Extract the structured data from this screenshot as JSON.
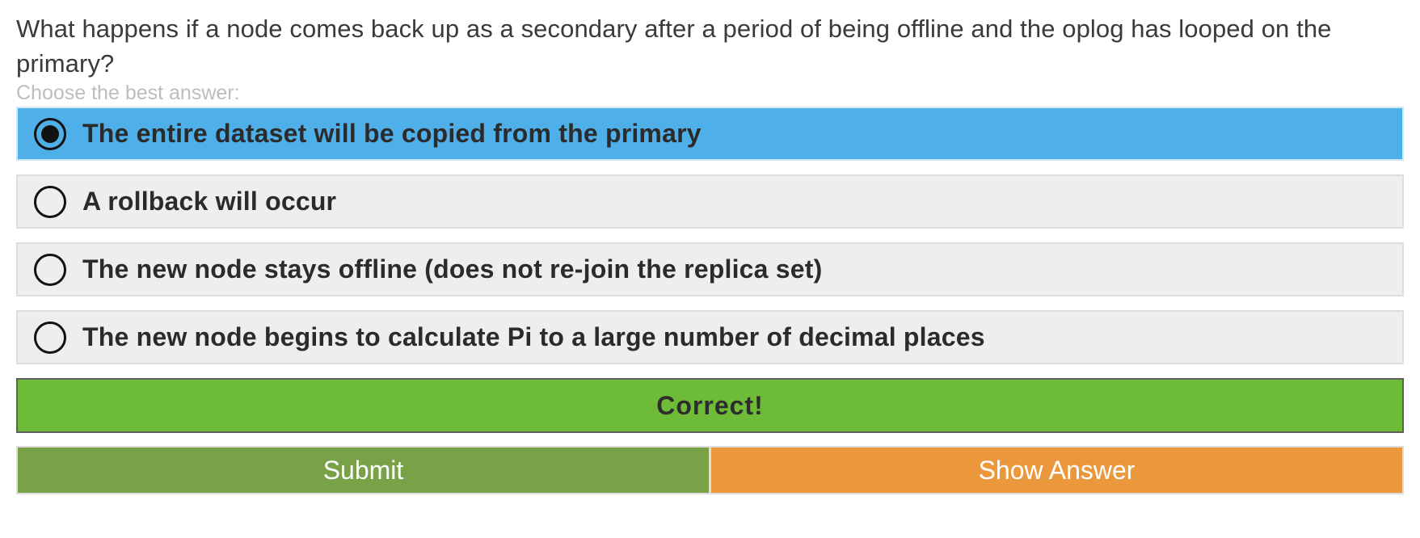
{
  "question": {
    "text": "What happens if a node comes back up as a secondary after a period of being offline and the oplog has looped on the primary?",
    "instruction": "Choose the best answer:"
  },
  "options": [
    {
      "label": "The entire dataset will be copied from the primary",
      "selected": true
    },
    {
      "label": "A rollback will occur",
      "selected": false
    },
    {
      "label": "The new node stays offline (does not re-join the replica set)",
      "selected": false
    },
    {
      "label": "The new node begins to calculate Pi to a large number of decimal places",
      "selected": false
    }
  ],
  "result": {
    "text": "Correct!"
  },
  "actions": {
    "submit_label": "Submit",
    "show_answer_label": "Show Answer"
  },
  "colors": {
    "selected_option": "#4fafe8",
    "option_background": "#eeeeee",
    "correct_banner": "#6dbb36",
    "submit_button": "#79a248",
    "show_answer_button": "#eb973c"
  }
}
